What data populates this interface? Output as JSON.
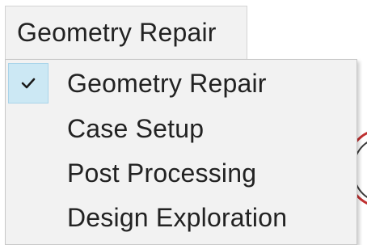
{
  "dropdown": {
    "selected_label": "Geometry Repair"
  },
  "menu": {
    "items": [
      {
        "label": "Geometry Repair",
        "checked": true,
        "icon": "check-icon"
      },
      {
        "label": "Case Setup",
        "checked": false
      },
      {
        "label": "Post Processing",
        "checked": false
      },
      {
        "label": "Design Exploration",
        "checked": false
      }
    ]
  },
  "colors": {
    "menu_background": "#f2f2f2",
    "check_highlight": "#cce8f4",
    "text": "#222222"
  }
}
